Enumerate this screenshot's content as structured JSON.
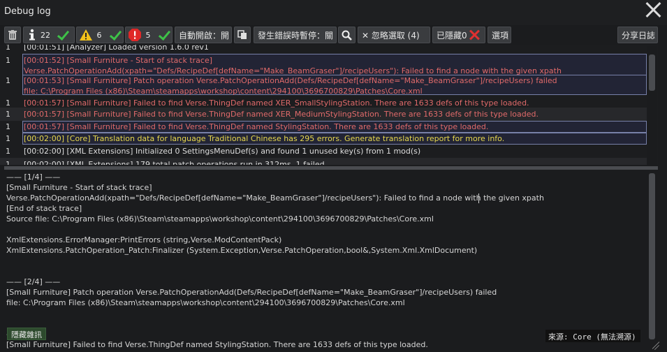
{
  "window": {
    "title": "Debug log"
  },
  "toolbar": {
    "message_count": "22",
    "warning_count": "6",
    "error_count": "5",
    "auto_open_label": "自動開啟：開",
    "pause_on_error_label": "發生錯誤時暫停：關",
    "ignore_selected_label": "✕ 忽略選取 (4)",
    "hidden_label": "已隱藏0",
    "options_label": "選項",
    "share_label": "分享日誌"
  },
  "log_rows": [
    {
      "count": "1",
      "text": "[00:01:51] [Analyzer] Loaded version 1.6.0 rev1"
    },
    {
      "count": "1",
      "text": "[00:01:52] [Small Furniture - Start of stack trace]"
    },
    {
      "count": "",
      "text": "Verse.PatchOperationAdd(xpath=\"Defs/RecipeDef[defName=\"Make_BeamGraser\"]/recipeUsers\"): Failed to find a node with the given xpath"
    },
    {
      "count": "1",
      "text": "[00:01:53] [Small Furniture] Patch operation Verse.PatchOperationAdd(Defs/RecipeDef[defName=\"Make_BeamGraser\"]/recipeUsers) failed"
    },
    {
      "count": "",
      "text": "file: C:\\Program Files (x86)\\Steam\\steamapps\\workshop\\content\\294100\\3696700829\\Patches\\Core.xml"
    },
    {
      "count": "1",
      "text": "[00:01:57] [Small Furniture] Failed to find Verse.ThingDef named XER_SmallStylingStation. There are 1633 defs of this type loaded."
    },
    {
      "count": "1",
      "text": "[00:01:57] [Small Furniture] Failed to find Verse.ThingDef named XER_MediumStylingStation. There are 1633 defs of this type loaded."
    },
    {
      "count": "1",
      "text": "[00:01:57] [Small Furniture] Failed to find Verse.ThingDef named StylingStation. There are 1633 defs of this type loaded."
    },
    {
      "count": "1",
      "text": "[00:02:00] [Core] Translation data for language Traditional Chinese has 295 errors. Generate translation report for more info."
    },
    {
      "count": "1",
      "text": "[00:02:00] [XML Extensions] Initialized 0 SettingsMenuDef(s) and found 1 unused key(s) from 1 mod(s)"
    },
    {
      "count": "1",
      "text": "[00:02:00] [XML Extensions] 179 total patch operations run in 312ms, 1 failed"
    }
  ],
  "detail_lines": [
    "—— [1/4] ——",
    "[Small Furniture - Start of stack trace]",
    "Verse.PatchOperationAdd(xpath=\"Defs/RecipeDef[defName=\"Make_BeamGraser\"]/recipeUsers\"): Failed to find a node with the given xpath",
    "[End of stack trace]",
    "Source file: C:\\Program Files (x86)\\Steam\\steamapps\\workshop\\content\\294100\\3696700829\\Patches\\Core.xml",
    "XmlExtensions.ErrorManager:PrintErrors (string,Verse.ModContentPack)",
    "XmlExtensions.PatchOperation_Patch:Finalizer (System.Exception,Verse.PatchOperation,bool&,System.Xml.XmlDocument)",
    "—— [2/4] ——",
    "[Small Furniture] Patch operation Verse.PatchOperationAdd(Defs/RecipeDef[defName=\"Make_BeamGraser\"]/recipeUsers) failed",
    "file: C:\\Program Files (x86)\\Steam\\steamapps\\workshop\\content\\294100\\3696700829\\Patches\\Core.xml",
    "——",
    "[Small Furniture] Failed to find Verse.ThingDef named StylingStation. There are 1633 defs of this type loaded."
  ],
  "footer": {
    "hide_noise_label": "隱藏雜訊",
    "source_label": "來源: Core (無法溯源)"
  },
  "colors": {
    "warning_text": "#e06a6a",
    "translation_text": "#e8d84e",
    "check_green": "#3ec248",
    "error_red": "#e03030",
    "highlight_border": "#7780a8"
  }
}
